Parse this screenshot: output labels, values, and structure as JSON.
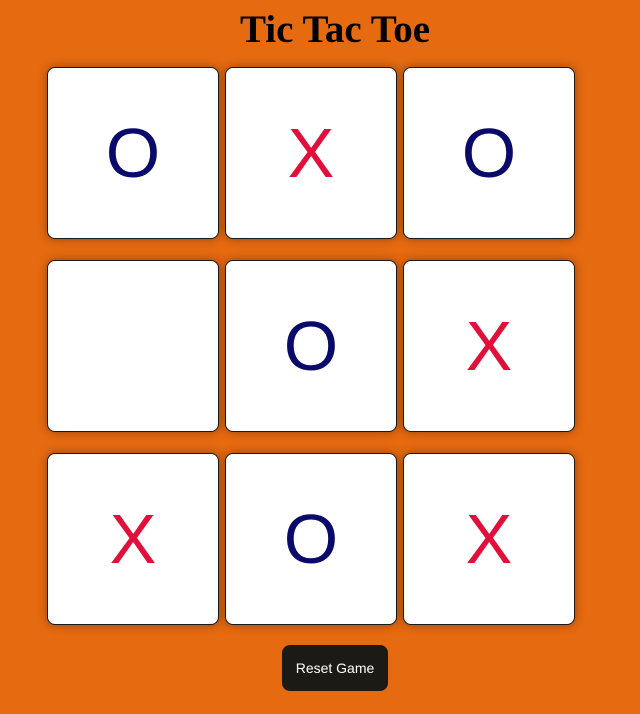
{
  "game": {
    "title": "Tic Tac Toe",
    "board": [
      "O",
      "X",
      "O",
      "",
      "O",
      "X",
      "X",
      "O",
      "X"
    ]
  },
  "controls": {
    "reset_label": "Reset Game"
  },
  "colors": {
    "background": "#e66a10",
    "x_mark": "#e0103a",
    "o_mark": "#0a0a6a",
    "button": "#1b1a14"
  }
}
